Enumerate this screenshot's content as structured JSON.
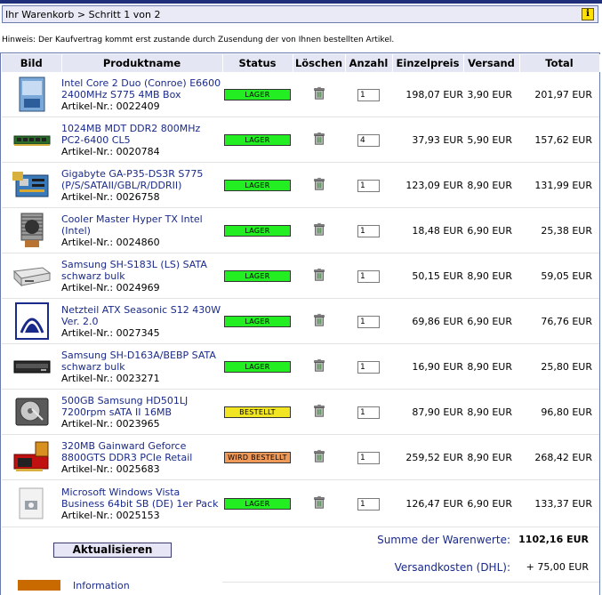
{
  "breadcrumb": "Ihr Warenkorb > Schritt 1 von 2",
  "info_glyph": "i",
  "hint": "Hinweis: Der Kaufvertrag kommt erst zustande durch Zusendung der von Ihnen bestellten Artikel.",
  "columns": [
    "Bild",
    "Produktname",
    "Status",
    "Löschen",
    "Anzahl",
    "Einzelpreis",
    "Versand",
    "Total"
  ],
  "colors": {
    "accent": "#1a2a8a",
    "lager": "#22ee22",
    "bestellt": "#f2e622",
    "wird_bestellt": "#f09a5a"
  },
  "rows": [
    {
      "name": "Intel Core 2 Duo (Conroe) E6600 2400MHz S775 4MB Box",
      "number": "Artikel-Nr.: 0022409",
      "status": "LAGER",
      "status_kind": "lager",
      "qty": "1",
      "unit": "198,07 EUR",
      "ship": "3,90 EUR",
      "total": "201,97 EUR",
      "image": "cpu-box"
    },
    {
      "name": "1024MB MDT DDR2 800MHz PC2-6400 CL5",
      "number": "Artikel-Nr.: 0020784",
      "status": "LAGER",
      "status_kind": "lager",
      "qty": "4",
      "unit": "37,93 EUR",
      "ship": "5,90 EUR",
      "total": "157,62 EUR",
      "image": "ram-module"
    },
    {
      "name": "Gigabyte GA-P35-DS3R S775 (P/S/SATAII/GBL/R/DDRII)",
      "number": "Artikel-Nr.: 0026758",
      "status": "LAGER",
      "status_kind": "lager",
      "qty": "1",
      "unit": "123,09 EUR",
      "ship": "8,90 EUR",
      "total": "131,99 EUR",
      "image": "motherboard"
    },
    {
      "name": "Cooler Master Hyper TX Intel (Intel)",
      "number": "Artikel-Nr.: 0024860",
      "status": "LAGER",
      "status_kind": "lager",
      "qty": "1",
      "unit": "18,48 EUR",
      "ship": "6,90 EUR",
      "total": "25,38 EUR",
      "image": "cpu-cooler"
    },
    {
      "name": "Samsung SH-S183L (LS) SATA schwarz bulk",
      "number": "Artikel-Nr.: 0024969",
      "status": "LAGER",
      "status_kind": "lager",
      "qty": "1",
      "unit": "50,15 EUR",
      "ship": "8,90 EUR",
      "total": "59,05 EUR",
      "image": "optical-drive"
    },
    {
      "name": "Netzteil ATX Seasonic S12 430W Ver. 2.0",
      "number": "Artikel-Nr.: 0027345",
      "status": "LAGER",
      "status_kind": "lager",
      "qty": "1",
      "unit": "69,86 EUR",
      "ship": "6,90 EUR",
      "total": "76,76 EUR",
      "image": "psu-logo"
    },
    {
      "name": "Samsung SH-D163A/BEBP SATA schwarz bulk",
      "number": "Artikel-Nr.: 0023271",
      "status": "LAGER",
      "status_kind": "lager",
      "qty": "1",
      "unit": "16,90 EUR",
      "ship": "8,90 EUR",
      "total": "25,80 EUR",
      "image": "optical-drive-black"
    },
    {
      "name": "500GB Samsung HD501LJ 7200rpm sATA II 16MB",
      "number": "Artikel-Nr.: 0023965",
      "status": "BESTELLT",
      "status_kind": "bestellt",
      "qty": "1",
      "unit": "87,90 EUR",
      "ship": "8,90 EUR",
      "total": "96,80 EUR",
      "image": "hard-drive"
    },
    {
      "name": "320MB Gainward Geforce 8800GTS DDR3 PCIe Retail",
      "number": "Artikel-Nr.: 0025683",
      "status": "WIRD BESTELLT",
      "status_kind": "wird_bestellt",
      "qty": "1",
      "unit": "259,52 EUR",
      "ship": "8,90 EUR",
      "total": "268,42 EUR",
      "image": "graphics-card"
    },
    {
      "name": "Microsoft Windows Vista Business 64bit SB (DE) 1er Pack",
      "number": "Artikel-Nr.: 0025153",
      "status": "LAGER",
      "status_kind": "lager",
      "qty": "1",
      "unit": "126,47 EUR",
      "ship": "6,90 EUR",
      "total": "133,37 EUR",
      "image": "software-box"
    }
  ],
  "update_label": "Aktualisieren",
  "sum_label": "Summe der Warenwerte:",
  "sum_value": "1102,16 EUR",
  "shipping_label": "Versandkosten (DHL):",
  "shipping_value": "+ 75,00 EUR",
  "info_link": "Information"
}
